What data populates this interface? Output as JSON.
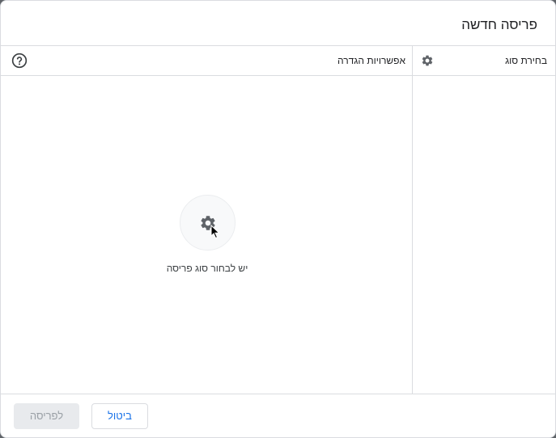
{
  "dialog": {
    "title": "פריסה חדשה"
  },
  "type_pane": {
    "title": "בחירת סוג",
    "icon": "gear-icon"
  },
  "options_pane": {
    "title": "אפשרויות הגדרה",
    "help_icon": "help-icon",
    "empty_state": {
      "icon": "gear-icon",
      "message": "יש לבחור סוג פריסה"
    }
  },
  "footer": {
    "apply_label": "לפריסה",
    "cancel_label": "ביטול"
  },
  "colors": {
    "accent": "#1a73e8",
    "border": "#dadce0",
    "disabled_bg": "#e8eaed",
    "disabled_text": "#9aa0a6"
  }
}
